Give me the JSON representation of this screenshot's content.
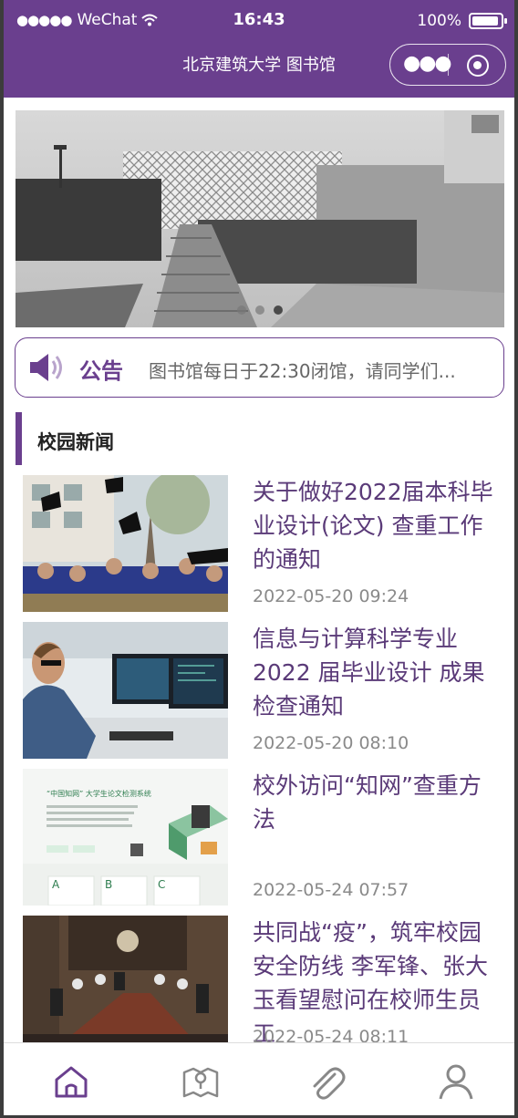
{
  "status_bar": {
    "carrier": "WeChat",
    "time": "16:43",
    "battery": "100%"
  },
  "nav": {
    "title": "北京建筑大学 图书馆"
  },
  "banner": {
    "slides": 3,
    "active_slide": 1
  },
  "notice": {
    "label": "公告",
    "text": "图书馆每日于22:30闭馆，请同学们..."
  },
  "section": {
    "title": "校园新闻"
  },
  "news": [
    {
      "title": "关于做好2022届本科毕业设计(论文) 查重工作的通知",
      "date": "2022-05-20 09:24"
    },
    {
      "title": "信息与计算科学专业2022 届毕业设计 成果检查通知",
      "date": "2022-05-20 08:10"
    },
    {
      "title": "校外访问“知网”查重方法",
      "date": "2022-05-24 07:57",
      "thumb": {
        "heading": "“中国知网” 大学生论文检测系统",
        "cards": [
          "A",
          "B",
          "C"
        ]
      }
    },
    {
      "title": "共同战“疫”，筑牢校园安全防线 李军锋、张大玉看望慰问在校师生员工",
      "date": "2022-05-24 08:11"
    }
  ],
  "tabbar": {
    "items": [
      {
        "icon": "home-icon",
        "active": true
      },
      {
        "icon": "map-icon",
        "active": false
      },
      {
        "icon": "paperclip-icon",
        "active": false
      },
      {
        "icon": "user-icon",
        "active": false
      }
    ]
  },
  "colors": {
    "brand": "#6a3f8e",
    "title": "#5a3a78",
    "date": "#8a8a8a"
  }
}
